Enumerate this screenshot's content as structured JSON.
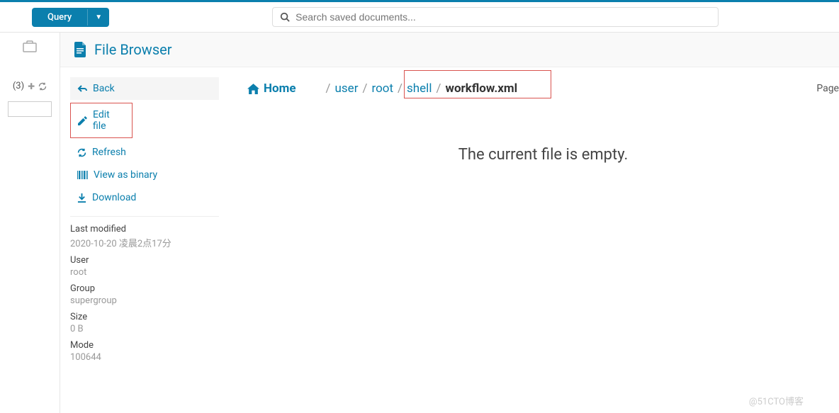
{
  "navbar": {
    "query_label": "Query",
    "search_placeholder": "Search saved documents..."
  },
  "assist": {
    "doc_count": "(3)"
  },
  "title": "File Browser",
  "actions": {
    "back": "Back",
    "edit": "Edit file",
    "refresh": "Refresh",
    "binary": "View as binary",
    "download": "Download"
  },
  "meta": {
    "lm_label": "Last modified",
    "lm_value": "2020-10-20 凌晨2点17分",
    "user_label": "User",
    "user_value": "root",
    "group_label": "Group",
    "group_value": "supergroup",
    "size_label": "Size",
    "size_value": "0 B",
    "mode_label": "Mode",
    "mode_value": "100644"
  },
  "breadcrumbs": {
    "home": "Home",
    "parts": [
      "user",
      "root",
      "shell"
    ],
    "current": "workflow.xml",
    "page_label": "Page"
  },
  "empty_message": "The current file is empty.",
  "watermark": "@51CTO博客"
}
